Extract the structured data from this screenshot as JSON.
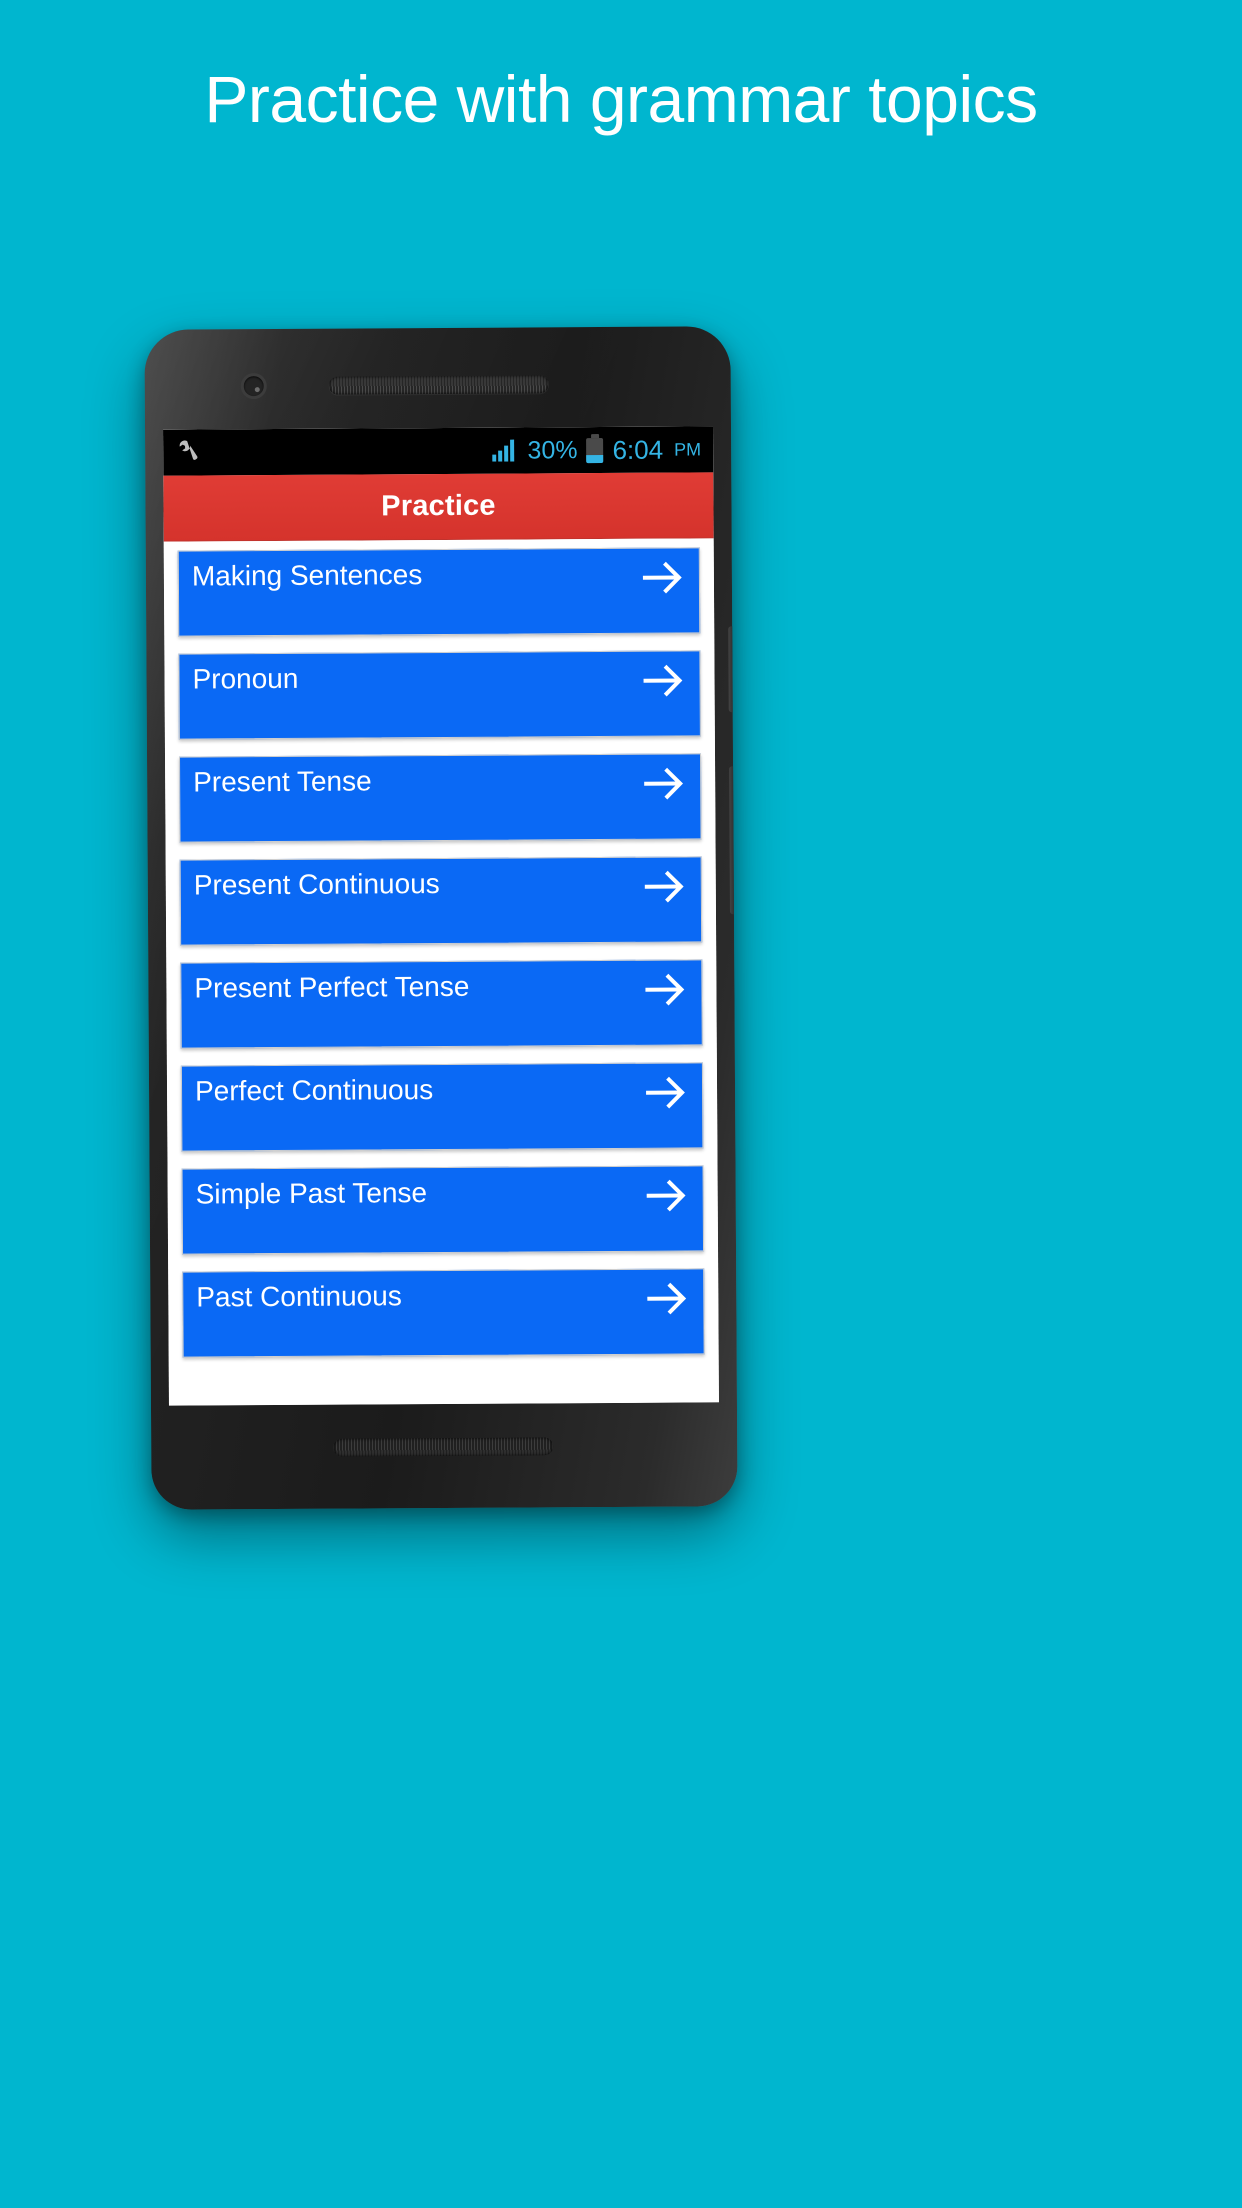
{
  "headline": "Practice with grammar topics",
  "colors": {
    "background": "#00b6cf",
    "actionbar": "#d5332c",
    "list_item": "#0a69f5",
    "status_accent": "#34b4e4",
    "text_on_blue": "#ffffff"
  },
  "device": {
    "hardware": {
      "camera": "camera-icon",
      "earpiece": "earpiece-speaker",
      "bottom_speaker": "bottom-speaker",
      "power_button": "power-button",
      "volume_button": "volume-button"
    }
  },
  "statusbar": {
    "wrench": "wrench-icon",
    "signal": "signal-icon",
    "battery_percent": "30%",
    "battery": "battery-icon",
    "time": "6:04",
    "ampm": "PM"
  },
  "actionbar": {
    "title": "Practice"
  },
  "list": {
    "items": [
      {
        "label": "Making Sentences",
        "arrow": "arrow-right-icon"
      },
      {
        "label": "Pronoun",
        "arrow": "arrow-right-icon"
      },
      {
        "label": "Present Tense",
        "arrow": "arrow-right-icon"
      },
      {
        "label": "Present Continuous",
        "arrow": "arrow-right-icon"
      },
      {
        "label": "Present Perfect Tense",
        "arrow": "arrow-right-icon"
      },
      {
        "label": "Perfect Continuous",
        "arrow": "arrow-right-icon"
      },
      {
        "label": "Simple Past Tense",
        "arrow": "arrow-right-icon"
      },
      {
        "label": "Past Continuous",
        "arrow": "arrow-right-icon"
      }
    ]
  }
}
